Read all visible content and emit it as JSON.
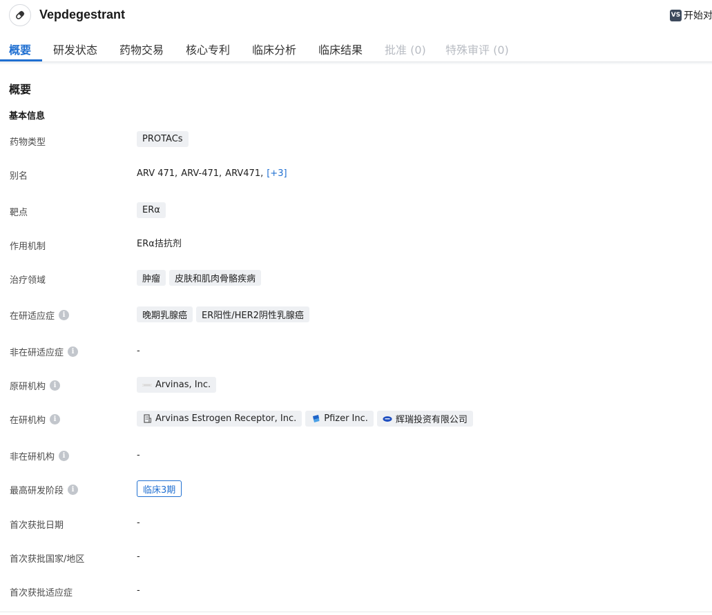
{
  "header": {
    "drug_name": "Vepdegestrant",
    "compare_icon": "VS",
    "compare_label": "开始对"
  },
  "tabs": [
    {
      "label": "概要",
      "state": "active"
    },
    {
      "label": "研发状态",
      "state": "normal"
    },
    {
      "label": "药物交易",
      "state": "normal"
    },
    {
      "label": "核心专利",
      "state": "normal"
    },
    {
      "label": "临床分析",
      "state": "normal"
    },
    {
      "label": "临床结果",
      "state": "normal"
    },
    {
      "label": "批准 (0)",
      "state": "disabled"
    },
    {
      "label": "特殊审评 (0)",
      "state": "disabled"
    }
  ],
  "overview": {
    "title": "概要",
    "basic_info_title": "基本信息",
    "rows": {
      "drug_type": {
        "label": "药物类型",
        "tags": [
          "PROTACs"
        ]
      },
      "aliases": {
        "label": "别名",
        "values": [
          "ARV 471,",
          "ARV-471,",
          "ARV471,"
        ],
        "more": "[+3]"
      },
      "target": {
        "label": "靶点",
        "tags": [
          "ERα"
        ]
      },
      "mechanism": {
        "label": "作用机制",
        "value": "ERα拮抗剂"
      },
      "therapeutic_area": {
        "label": "治疗领域",
        "tags": [
          "肿瘤",
          "皮肤和肌肉骨骼疾病"
        ]
      },
      "active_indication": {
        "label": "在研适应症",
        "tags": [
          "晚期乳腺癌",
          "ER阳性/HER2阴性乳腺癌"
        ]
      },
      "inactive_indication": {
        "label": "非在研适应症",
        "value": "-"
      },
      "originator": {
        "label": "原研机构",
        "orgs": [
          "Arvinas, Inc."
        ]
      },
      "active_org": {
        "label": "在研机构",
        "orgs": [
          "Arvinas Estrogen Receptor, Inc.",
          "Pfizer Inc.",
          "辉瑞投资有限公司"
        ]
      },
      "inactive_org": {
        "label": "非在研机构",
        "value": "-"
      },
      "highest_phase": {
        "label": "最高研发阶段",
        "value": "临床3期"
      },
      "first_approval_date": {
        "label": "首次获批日期",
        "value": "-"
      },
      "first_approval_country": {
        "label": "首次获批国家/地区",
        "value": "-"
      },
      "first_approval_indication": {
        "label": "首次获批适应症",
        "value": "-"
      }
    }
  }
}
